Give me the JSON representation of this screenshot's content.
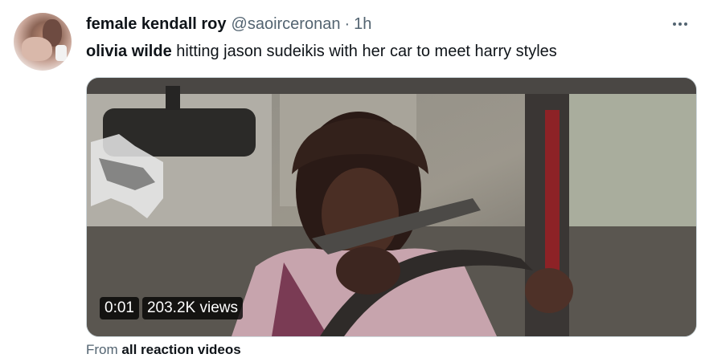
{
  "author": {
    "display_name": "female kendall roy",
    "handle": "@saoirceronan",
    "separator": "·",
    "time": "1h"
  },
  "tweet": {
    "mention": "olivia wilde",
    "text": " hitting jason sudeikis with her car to meet harry styles"
  },
  "video": {
    "duration": "0:01",
    "views": "203.2K views"
  },
  "source": {
    "prefix": "From ",
    "name": "all reaction videos"
  },
  "icons": {
    "more": "more-options-icon"
  }
}
